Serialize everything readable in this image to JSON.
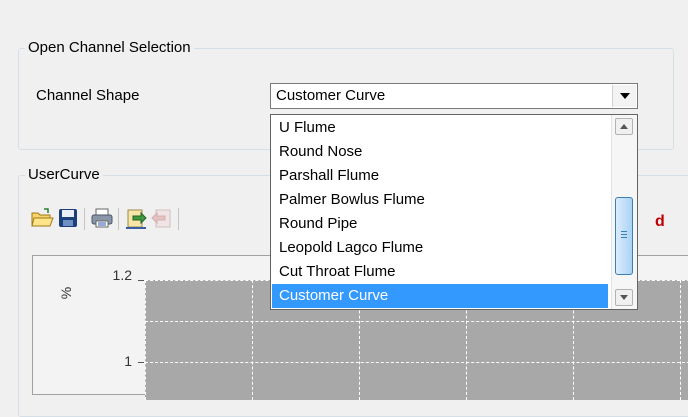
{
  "open_channel": {
    "group_title": "Open Channel Selection",
    "channel_shape_label": "Channel Shape",
    "selected_value": "Customer Curve",
    "options": [
      "U Flume",
      "Round Nose",
      "Parshall Flume",
      "Palmer Bowlus Flume",
      "Round Pipe",
      "Leopold Lagco Flume",
      "Cut Throat Flume",
      "Customer Curve"
    ],
    "highlighted_option": "Customer Curve"
  },
  "user_curve": {
    "group_title": "UserCurve",
    "toolbar": {
      "icons": [
        "open-folder-icon",
        "save-icon",
        "print-icon",
        "import-icon",
        "export-icon"
      ],
      "trailing_text": "d"
    },
    "chart": {
      "y_unit": "%",
      "y_ticks": [
        "1.2",
        "1"
      ]
    }
  },
  "colors": {
    "selection": "#3399ff",
    "plot_background": "#a8a8a8",
    "window_background": "#f0f0f0",
    "accent_red": "#c00000"
  }
}
